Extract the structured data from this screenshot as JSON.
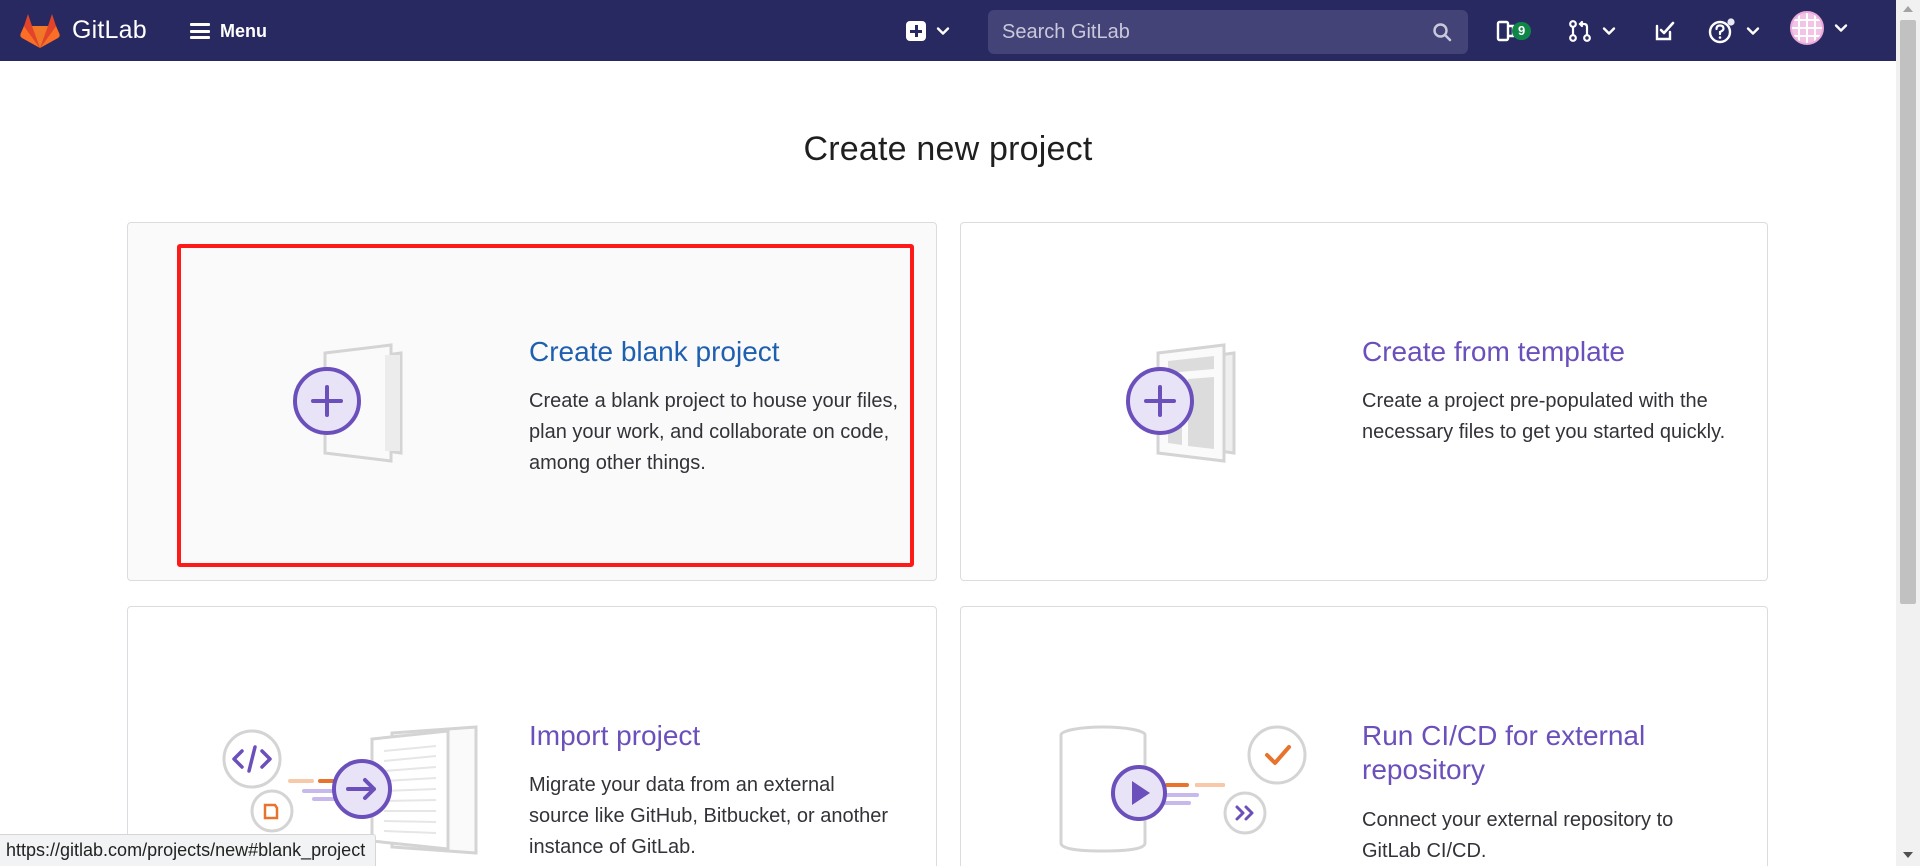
{
  "topbar": {
    "brand_name": "GitLab",
    "menu_label": "Menu",
    "search_placeholder": "Search GitLab",
    "issues_count": "9",
    "colors": {
      "background": "#292961",
      "search_bg": "#434378",
      "badge": "#108548"
    },
    "icons": [
      "gitlab-logo-icon",
      "menu-icon",
      "plus-square-icon",
      "chevron-down-icon",
      "search-icon",
      "issues-icon",
      "merge-request-icon",
      "todo-icon",
      "help-icon",
      "avatar"
    ]
  },
  "page": {
    "title": "Create new project"
  },
  "cards": [
    {
      "id": "blank_project",
      "title": "Create blank project",
      "description": "Create a blank project to house your files, plan your work, and collaborate on code, among other things.",
      "icon": "blank-project-icon",
      "selected": true
    },
    {
      "id": "create_from_template",
      "title": "Create from template",
      "description": "Create a project pre-populated with the necessary files to get you started quickly.",
      "icon": "template-project-icon",
      "selected": false
    },
    {
      "id": "import_project",
      "title": "Import project",
      "description": "Migrate your data from an external source like GitHub, Bitbucket, or another instance of GitLab.",
      "icon": "import-project-icon",
      "selected": false
    },
    {
      "id": "cicd_for_external_repo",
      "title": "Run CI/CD for external repository",
      "description": "Connect your external repository to GitLab CI/CD.",
      "icon": "cicd-project-icon",
      "selected": false
    }
  ],
  "colors": {
    "accent": "#6b4fbb",
    "selected_title": "#1f5fb0",
    "focus_ring": "#ff1a1a"
  },
  "status_bar": {
    "url": "https://gitlab.com/projects/new#blank_project"
  }
}
